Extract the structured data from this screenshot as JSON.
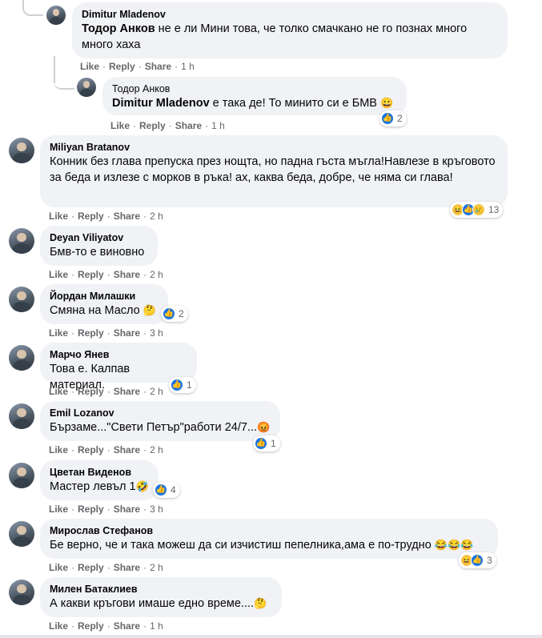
{
  "comments": [
    {
      "author": "Dimitur Mladenov",
      "mention": "Тодор Анков",
      "text": " не е ли Мини това, че толко смачкано не го познах много много хаха",
      "like": "Like",
      "reply": "Reply",
      "share": "Share",
      "time": "1 h"
    },
    {
      "author": "Тодор Анков",
      "mention": "Dimitur Mladenov",
      "text": " е така де! То минито си е БМВ",
      "emoji": "😀",
      "like": "Like",
      "reply": "Reply",
      "share": "Share",
      "time": "1 h",
      "reactions": {
        "count": "2",
        "icons": [
          "like-icon"
        ]
      }
    },
    {
      "author": "Miliyan Bratanov",
      "text": "Конник без глава препуска през нощта, но падна гъста мъгла!Навлезе в кръговото за беда и излезе с морков в ръка! ах, каква беда, добре, че няма си глава!",
      "like": "Like",
      "reply": "Reply",
      "share": "Share",
      "time": "2 h",
      "reactions": {
        "count": "13",
        "icons": [
          "haha-icon",
          "like-icon",
          "sad-icon"
        ]
      }
    },
    {
      "author": "Deyan Viliyatov",
      "text": "Бмв-то е виновно",
      "like": "Like",
      "reply": "Reply",
      "share": "Share",
      "time": "2 h"
    },
    {
      "author": "Йордан Милашки",
      "text": "Смяна на Масло",
      "emoji": "🤔",
      "like": "Like",
      "reply": "Reply",
      "share": "Share",
      "time": "3 h",
      "reactions": {
        "count": "2",
        "icons": [
          "like-icon"
        ]
      }
    },
    {
      "author": "Марчо Янев",
      "text": "Това е. Калпав материал.",
      "like": "Like",
      "reply": "Reply",
      "share": "Share",
      "time": "2 h",
      "reactions": {
        "count": "1",
        "icons": [
          "like-icon"
        ]
      }
    },
    {
      "author": "Emil Lozanov",
      "text": "Бързаме...\"Свети Петър\"работи 24/7...",
      "emoji": "😡",
      "like": "Like",
      "reply": "Reply",
      "share": "Share",
      "time": "2 h",
      "reactions": {
        "count": "1",
        "icons": [
          "like-icon"
        ]
      }
    },
    {
      "author": "Цветан Виденов",
      "text": "Мастер левъл 1",
      "emoji": "🤣",
      "like": "Like",
      "reply": "Reply",
      "share": "Share",
      "time": "3 h",
      "reactions": {
        "count": "4",
        "icons": [
          "like-icon"
        ]
      }
    },
    {
      "author": "Мирослав Стефанов",
      "text": "Бе верно, че и така можеш да си изчистиш пепелника,ама е по-трудно",
      "emoji": "😂😂😂",
      "like": "Like",
      "reply": "Reply",
      "share": "Share",
      "time": "2 h",
      "reactions": {
        "count": "3",
        "icons": [
          "haha-icon",
          "like-icon"
        ]
      }
    },
    {
      "author": "Милен Батаклиев",
      "text": "А какви кръгови имаше едно време....",
      "emoji": "🤔",
      "like": "Like",
      "reply": "Reply",
      "share": "Share",
      "time": "1 h"
    }
  ],
  "colors": {
    "bubble": "#f0f2f5",
    "meta_text": "#65676b",
    "like_blue": "#1b74e4",
    "thread_line": "#ced0d4"
  }
}
